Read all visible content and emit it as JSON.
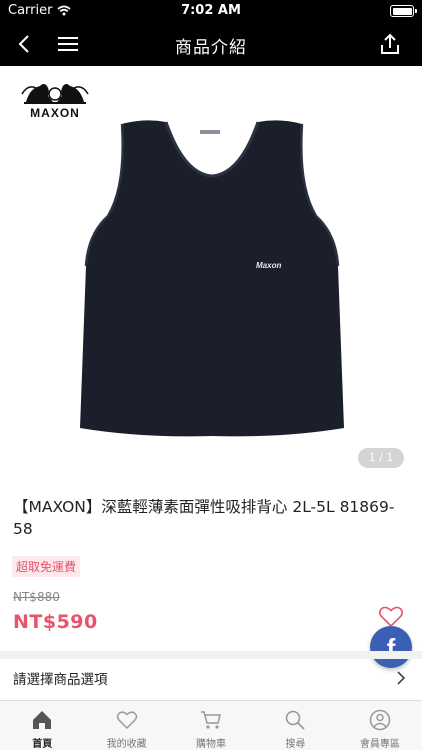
{
  "status_bar": {
    "carrier": "Carrier",
    "time": "7:02 AM"
  },
  "nav": {
    "title": "商品介紹"
  },
  "product": {
    "brand_word": "MAXON",
    "chest_logo": "Maxon",
    "pager": "1 / 1",
    "title": "【MAXON】深藍輕薄素面彈性吸排背心 2L-5L 81869-58",
    "badge": "超取免運費",
    "old_price": "NT$880",
    "price": "NT$590",
    "garment_color": "#1b1f2b"
  },
  "options": {
    "label": "請選擇商品選項"
  },
  "social": {
    "fb_glyph": "f"
  },
  "tabs": [
    {
      "label": "首頁",
      "icon": "home-icon",
      "active": true
    },
    {
      "label": "我的收藏",
      "icon": "heart-icon",
      "active": false
    },
    {
      "label": "購物車",
      "icon": "cart-icon",
      "active": false
    },
    {
      "label": "搜尋",
      "icon": "search-icon",
      "active": false
    },
    {
      "label": "會員專區",
      "icon": "user-icon",
      "active": false
    }
  ],
  "colors": {
    "accent": "#e8556b",
    "facebook": "#3b5fb4",
    "nav_bg": "#000000"
  }
}
